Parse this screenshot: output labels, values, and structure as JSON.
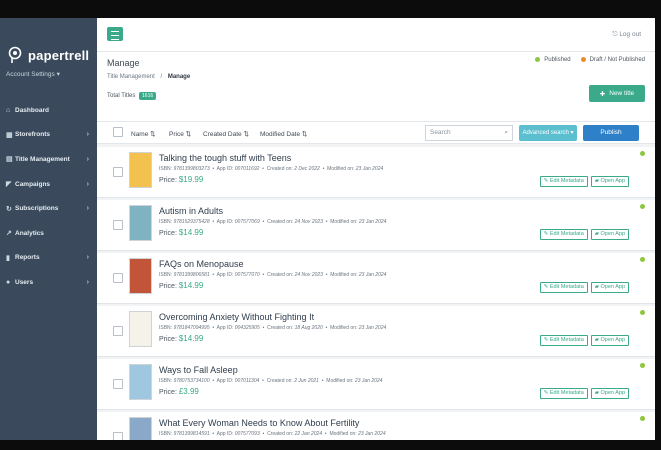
{
  "app": {
    "brand": "papertrell",
    "account_label": "Account Settings ▾",
    "logout_label": "Log out"
  },
  "sidebar": {
    "items": [
      {
        "label": "Dashboard",
        "icon": "home-icon",
        "glyph": "⌂",
        "chevron": false
      },
      {
        "label": "Storefronts",
        "icon": "grid-icon",
        "glyph": "▦",
        "chevron": true
      },
      {
        "label": "Title Management",
        "icon": "book-icon",
        "glyph": "▤",
        "chevron": true
      },
      {
        "label": "Campaigns",
        "icon": "megaphone-icon",
        "glyph": "◤",
        "chevron": true
      },
      {
        "label": "Subscriptions",
        "icon": "refresh-icon",
        "glyph": "↻",
        "chevron": true
      },
      {
        "label": "Analytics",
        "icon": "chart-icon",
        "glyph": "↗",
        "chevron": false
      },
      {
        "label": "Reports",
        "icon": "chart-bar-icon",
        "glyph": "▮",
        "chevron": true
      },
      {
        "label": "Users",
        "icon": "users-icon",
        "glyph": "●",
        "chevron": true
      }
    ]
  },
  "header": {
    "page_title": "Manage",
    "breadcrumb_parent": "Title Management",
    "breadcrumb_sep": "/",
    "breadcrumb_current": "Manage",
    "total_label": "Total Titles",
    "total_count": "1616",
    "legend_published": "Published",
    "legend_draft": "Draft / Not Published",
    "new_title_label": "New title"
  },
  "colors": {
    "accent": "#3aaa8a",
    "published": "#8dc63f",
    "draft": "#f08a24",
    "publish_button": "#2e80c9",
    "advanced_button": "#5bbfcf"
  },
  "toolbar": {
    "sort_name": "Name ⇅",
    "sort_price": "Price ⇅",
    "sort_created": "Created Date ⇅",
    "sort_modified": "Modified Date ⇅",
    "search_placeholder": "Search",
    "advanced_label": "Advanced search ▾",
    "publish_label": "Publish"
  },
  "titles": [
    {
      "title": "Talking the tough stuff with Teens",
      "isbn": "9781399803273",
      "app_id": "007011692",
      "created": "2 Dec 2022",
      "modified": "23 Jan 2024",
      "price": "$19.99",
      "cover_color": "#f2c14e"
    },
    {
      "title": "Autism in Adults",
      "isbn": "9781529375428",
      "app_id": "007577069",
      "created": "24 Nov 2023",
      "modified": "23 Jan 2024",
      "price": "$14.99",
      "cover_color": "#7fb3c2"
    },
    {
      "title": "FAQs on Menopause",
      "isbn": "9781399806581",
      "app_id": "007577070",
      "created": "24 Nov 2023",
      "modified": "23 Jan 2024",
      "price": "$14.99",
      "cover_color": "#c2543a"
    },
    {
      "title": "Overcoming Anxiety Without Fighting It",
      "isbn": "9781847094995",
      "app_id": "004325905",
      "created": "18 Aug 2020",
      "modified": "23 Jan 2024",
      "price": "$14.99",
      "cover_color": "#f5f2ea"
    },
    {
      "title": "Ways to Fall Asleep",
      "isbn": "9780753734100",
      "app_id": "007011304",
      "created": "2 Jun 2021",
      "modified": "23 Jan 2024",
      "price": "£3.99",
      "cover_color": "#9fc7e0"
    },
    {
      "title": "What Every Woman Needs to Know About Fertility",
      "isbn": "9781399814591",
      "app_id": "007577093",
      "created": "22 Jan 2024",
      "modified": "23 Jan 2024",
      "price": "",
      "cover_color": "#8aa9c9"
    }
  ],
  "row_labels": {
    "isbn": "ISBN:",
    "app_id": "App ID:",
    "created": "Created on:",
    "modified": "Modified on:",
    "price": "Price:",
    "edit": "Edit Metadata",
    "open": "Open App"
  }
}
